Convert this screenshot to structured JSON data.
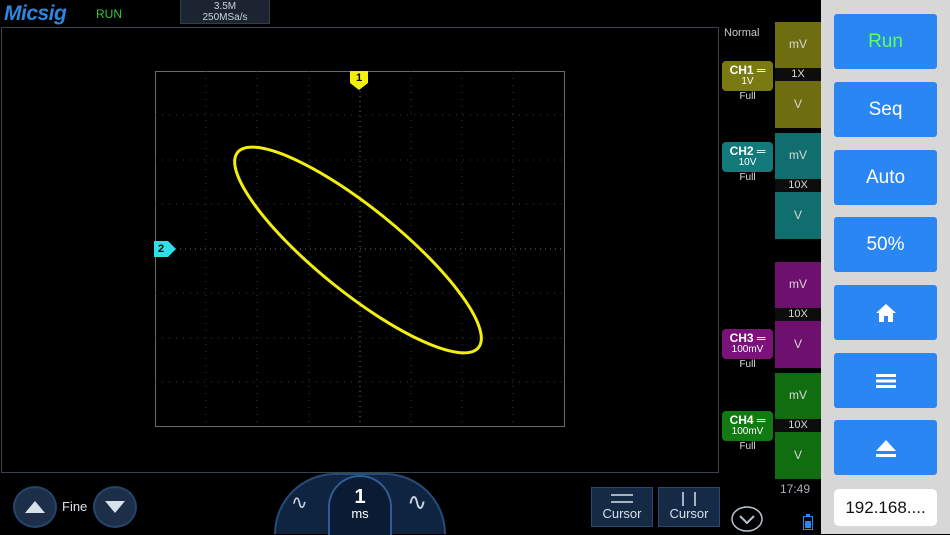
{
  "top": {
    "brand": "Micsig",
    "run_state": "RUN",
    "memory_depth": "3.5M",
    "sample_rate": "250MSa/s"
  },
  "trigger_mode": "Normal",
  "markers": {
    "ch1": "1",
    "ch2": "2"
  },
  "channels": [
    {
      "name": "CH1",
      "scale": "1V",
      "coupling": "Full",
      "probe": "1X",
      "unit_top": "mV",
      "unit_bottom": "V",
      "color": "#7a7a12"
    },
    {
      "name": "CH2",
      "scale": "10V",
      "coupling": "Full",
      "probe": "10X",
      "unit_top": "mV",
      "unit_bottom": "V",
      "color": "#127a7a"
    },
    {
      "name": "CH3",
      "scale": "100mV",
      "coupling": "Full",
      "probe": "10X",
      "unit_top": "mV",
      "unit_bottom": "V",
      "color": "#7a127a"
    },
    {
      "name": "CH4",
      "scale": "100mV",
      "coupling": "Full",
      "probe": "10X",
      "unit_top": "mV",
      "unit_bottom": "V",
      "color": "#127a12"
    }
  ],
  "clock": "17:49",
  "buttons": {
    "run": "Run",
    "seq": "Seq",
    "auto": "Auto",
    "fifty": "50%",
    "ip": "192.168...."
  },
  "bottom": {
    "fine": "Fine",
    "timebase_value": "1",
    "timebase_unit": "ms",
    "cursor_h": "Cursor",
    "cursor_v": "Cursor"
  },
  "colors": {
    "trace": "#f2ee0f",
    "ch2_marker": "#2fe0e8",
    "accent_button": "#2a86f2",
    "run_text": "#5fff5f"
  }
}
